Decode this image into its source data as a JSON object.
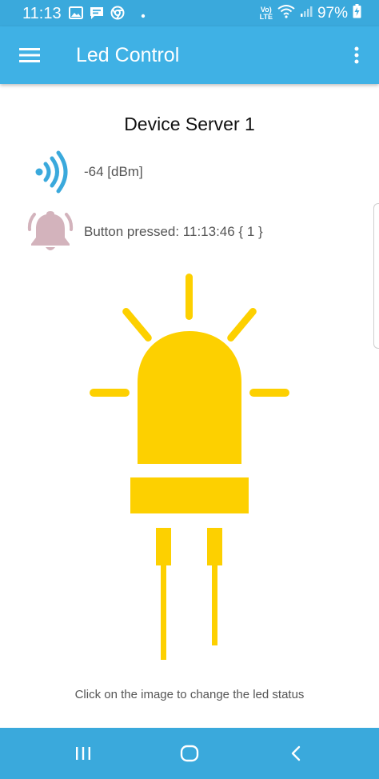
{
  "status_bar": {
    "time": "11:13",
    "battery": "97%",
    "network_label_top": "Vo)",
    "network_label_bottom": "LTE",
    "notification_icons": [
      "image-icon",
      "chat-icon",
      "chrome-icon",
      "dot-icon"
    ],
    "system_icons": [
      "wifi-icon",
      "signal-icon",
      "battery-charging-icon"
    ]
  },
  "app_bar": {
    "title": "Led Control",
    "menu_icon": "hamburger-menu-icon",
    "overflow_icon": "more-vert-icon"
  },
  "device": {
    "title": "Device Server 1",
    "signal_text": "-64 [dBm]",
    "button_text": "Button pressed: 11:13:46 { 1 }"
  },
  "led": {
    "icon": "led-bulb-icon",
    "state": "on"
  },
  "hint": "Click on the image to change the led status",
  "nav_bar": {
    "items": [
      "recents-icon",
      "home-icon",
      "back-icon"
    ]
  },
  "colors": {
    "status_bar": "#3aa9dc",
    "app_bar": "#3fb1e5",
    "led_on": "#fdd000",
    "signal": "#3aa9dc",
    "bell": "#d3b3bc"
  }
}
